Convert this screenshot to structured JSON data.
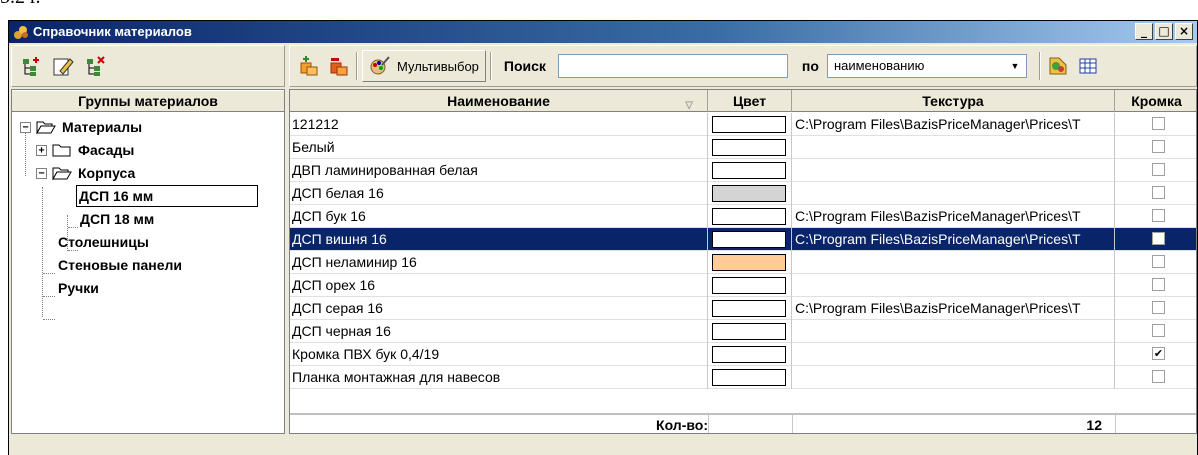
{
  "page_number": "5.2 r.",
  "window": {
    "title": "Справочник материалов",
    "controls": {
      "minimize": "_",
      "maximize": "□",
      "close": "×"
    }
  },
  "left_toolbar": {
    "icons": [
      "add-group-icon",
      "edit-group-icon",
      "delete-group-icon"
    ]
  },
  "groups_panel": {
    "header": "Группы материалов",
    "tree": [
      {
        "label": "Материалы",
        "expander": "−"
      },
      {
        "label": "Фасады",
        "expander": "+"
      },
      {
        "label": "Корпуса",
        "expander": "−"
      },
      {
        "label": "ДСП 16 мм"
      },
      {
        "label": "ДСП 18 мм"
      },
      {
        "label": "Столешницы"
      },
      {
        "label": "Стеновые панели"
      },
      {
        "label": "Ручки"
      }
    ]
  },
  "toolbar": {
    "multiselect_label": "Мультивыбор",
    "search_label": "Поиск",
    "search_value": "",
    "by_label": "по",
    "by_value": "наименованию"
  },
  "grid": {
    "columns": {
      "name": "Наименование",
      "color": "Цвет",
      "texture": "Текстура",
      "edge": "Кромка"
    },
    "rows": [
      {
        "name": "121212",
        "color": "#ffffff",
        "texture": "C:\\Program Files\\BazisPriceManager\\Prices\\T",
        "edge": false
      },
      {
        "name": "Белый",
        "color": "#ffffff",
        "texture": "",
        "edge": false
      },
      {
        "name": "ДВП ламинированная белая",
        "color": "#ffffff",
        "texture": "",
        "edge": false
      },
      {
        "name": "ДСП белая 16",
        "color": "#d4d4d4",
        "texture": "",
        "edge": false
      },
      {
        "name": "ДСП бук 16",
        "color": "#ffffff",
        "texture": "C:\\Program Files\\BazisPriceManager\\Prices\\T",
        "edge": false
      },
      {
        "name": "ДСП вишня 16",
        "color": "#ffffff",
        "texture": "C:\\Program Files\\BazisPriceManager\\Prices\\T",
        "edge": false,
        "selected": true
      },
      {
        "name": "ДСП неламинир 16",
        "color": "#ffcc99",
        "texture": "",
        "edge": false
      },
      {
        "name": "ДСП орех 16",
        "color": "#ffffff",
        "texture": "",
        "edge": false
      },
      {
        "name": "ДСП серая 16",
        "color": "#ffffff",
        "texture": "C:\\Program Files\\BazisPriceManager\\Prices\\T",
        "edge": false
      },
      {
        "name": "ДСП черная 16",
        "color": "#ffffff",
        "texture": "",
        "edge": false
      },
      {
        "name": "Кромка ПВХ бук 0,4/19",
        "color": "#ffffff",
        "texture": "",
        "edge": true
      },
      {
        "name": "Планка монтажная для навесов",
        "color": "#ffffff",
        "texture": "",
        "edge": false
      }
    ],
    "footer": {
      "count_label": "Кол-во:",
      "count_value": "12"
    }
  },
  "colors": {
    "title_bar": "#0a246a",
    "selection": "#0a246a",
    "window_bg": "#ece9d8"
  }
}
